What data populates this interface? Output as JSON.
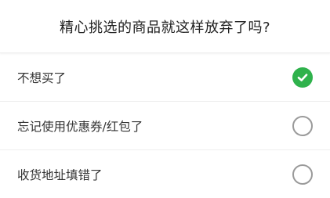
{
  "dialog": {
    "title": "精心挑选的商品就这样放弃了吗?"
  },
  "options": [
    {
      "label": "不想买了",
      "selected": true
    },
    {
      "label": "忘记使用优惠券/红包了",
      "selected": false
    },
    {
      "label": "收货地址填错了",
      "selected": false
    }
  ],
  "colors": {
    "accent": "#2fb24c",
    "unchecked_border": "#9a9a9a",
    "divider": "#eeeeee",
    "text": "#333333"
  },
  "icons": {
    "checked": "check-circle-icon",
    "unchecked": "empty-circle-icon"
  }
}
